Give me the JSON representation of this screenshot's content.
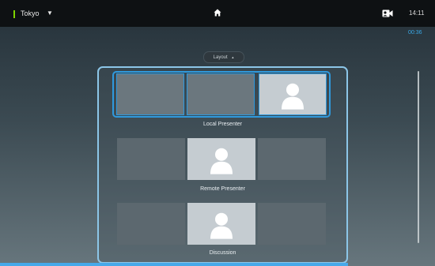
{
  "topbar": {
    "location": "Tokyo",
    "location_arrow": "▼",
    "time": "14:11"
  },
  "status": {
    "call_timer": "00:36"
  },
  "layout_menu": {
    "button_label": "Layout",
    "button_caret": "▲"
  },
  "layouts": [
    {
      "label": "Local Presenter",
      "selected": true
    },
    {
      "label": "Remote Presenter",
      "selected": false
    },
    {
      "label": "Discussion",
      "selected": false
    }
  ],
  "colors": {
    "accent": "#2f99dd",
    "indicator": "#7fd400",
    "timer": "#39a8e6"
  },
  "icons": {
    "home": "home-icon",
    "camera": "camera-icon",
    "person": "person-icon"
  }
}
